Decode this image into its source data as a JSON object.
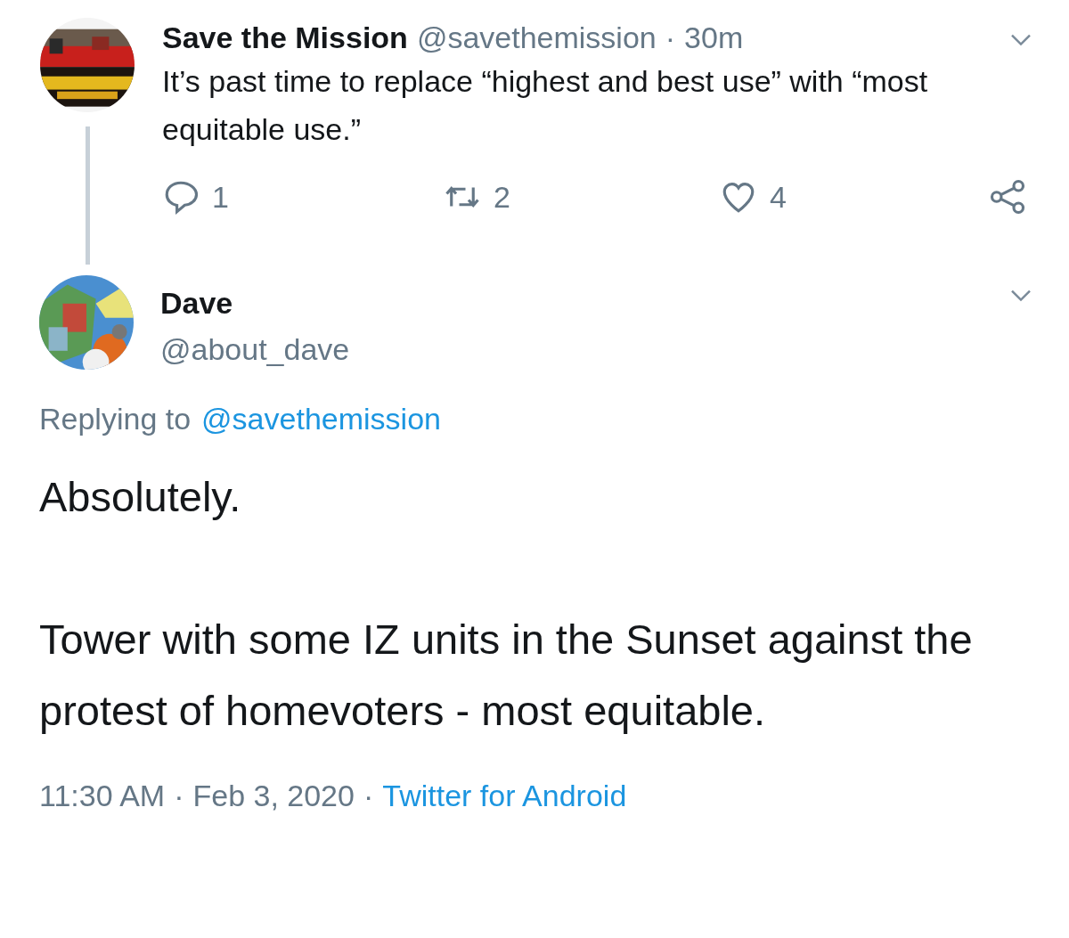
{
  "parent_tweet": {
    "kind": "picture",
    "name": "Save the Mission",
    "handle": "@savethemission",
    "separator": "·",
    "time": "30m",
    "text": "It’s past time to replace “highest and best use” with “most equitable use.”",
    "actions": [
      {
        "kind": "reply",
        "count": "1"
      },
      {
        "kind": "retweet",
        "count": "2"
      },
      {
        "kind": "like",
        "count": "4"
      },
      {
        "kind": "share"
      }
    ]
  },
  "reply_tweet": {
    "kind": "picture",
    "name": "Dave",
    "handle": "@about_dave",
    "replying_label": "Replying to",
    "replying_to": "@savethemission",
    "paragraphs": [
      "Absolutely.",
      "Tower with some IZ units in the Sunset against the protest of homevoters - most equitable."
    ],
    "time": "11:30 AM",
    "separator_1": "·",
    "date": "Feb 3, 2020",
    "separator_2": "·",
    "source": "Twitter for Android"
  }
}
